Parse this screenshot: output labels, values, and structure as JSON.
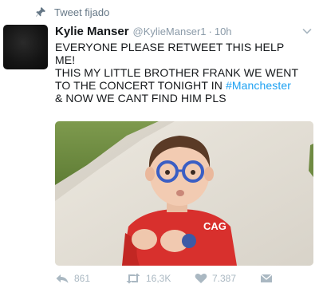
{
  "pinned": {
    "label": "Tweet fijado",
    "icon": "pin-icon"
  },
  "tweet": {
    "author": {
      "name": "Kylie Manser",
      "handle": "@KylieManser1",
      "avatar": "avatar"
    },
    "separator": "·",
    "time": "10h",
    "text": {
      "line1": "EVERYONE PLEASE RETWEET THIS HELP",
      "line2": "ME!",
      "line3": "THIS MY LITTLE BROTHER FRANK WE WENT",
      "line4_prefix": "TO THE CONCERT TONIGHT IN ",
      "hashtag": "#Manchester",
      "line5": "& NOW WE CANT FIND HIM PLS"
    },
    "media": {
      "shirt_text": "CAG"
    },
    "actions": {
      "replies": "861",
      "retweets": "16,3K",
      "likes": "7.387"
    }
  },
  "colors": {
    "accent": "#1da1f2",
    "muted": "#aab8c2",
    "text": "#14171a"
  }
}
